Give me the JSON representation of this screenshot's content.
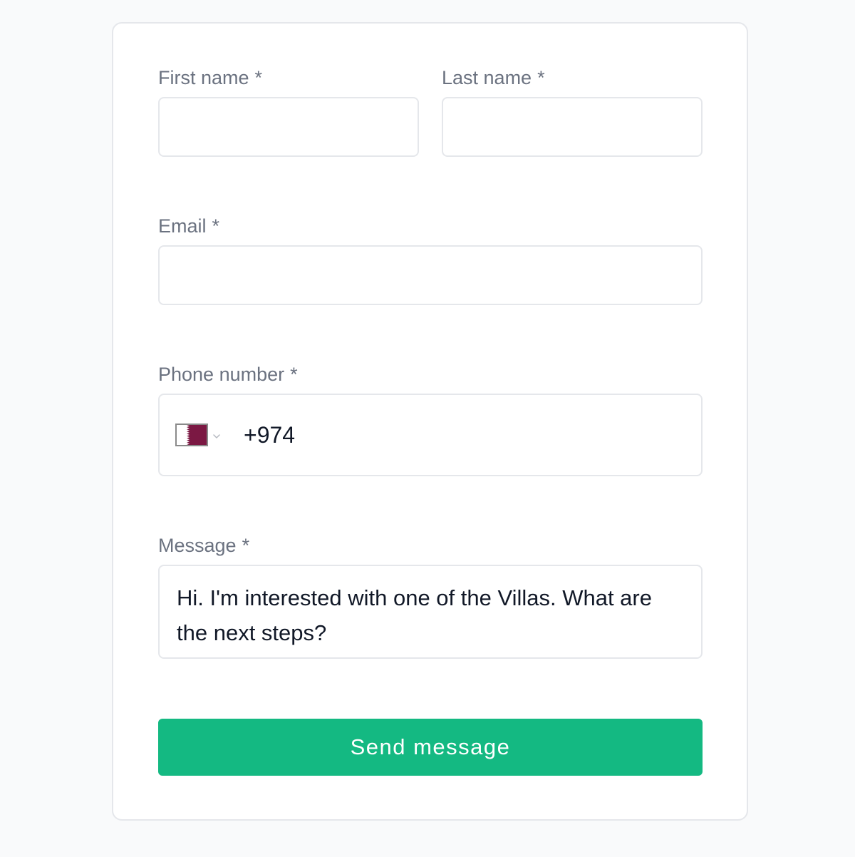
{
  "form": {
    "first_name": {
      "label": "First name",
      "required_mark": "*",
      "value": ""
    },
    "last_name": {
      "label": "Last name",
      "required_mark": "*",
      "value": ""
    },
    "email": {
      "label": "Email",
      "required_mark": "*",
      "value": ""
    },
    "phone": {
      "label": "Phone number",
      "required_mark": "*",
      "country_flag_icon": "qatar-flag-icon",
      "dropdown_icon": "chevron-down-icon",
      "value": "+974"
    },
    "message": {
      "label": "Message",
      "required_mark": "*",
      "value": "Hi. I'm interested with one of the Villas. What are the next steps?"
    },
    "submit_label": "Send message"
  },
  "colors": {
    "accent": "#14b982",
    "label_text": "#6b7280",
    "input_text": "#111827",
    "border": "#e5e7eb",
    "flag_maroon": "#7b1843"
  }
}
